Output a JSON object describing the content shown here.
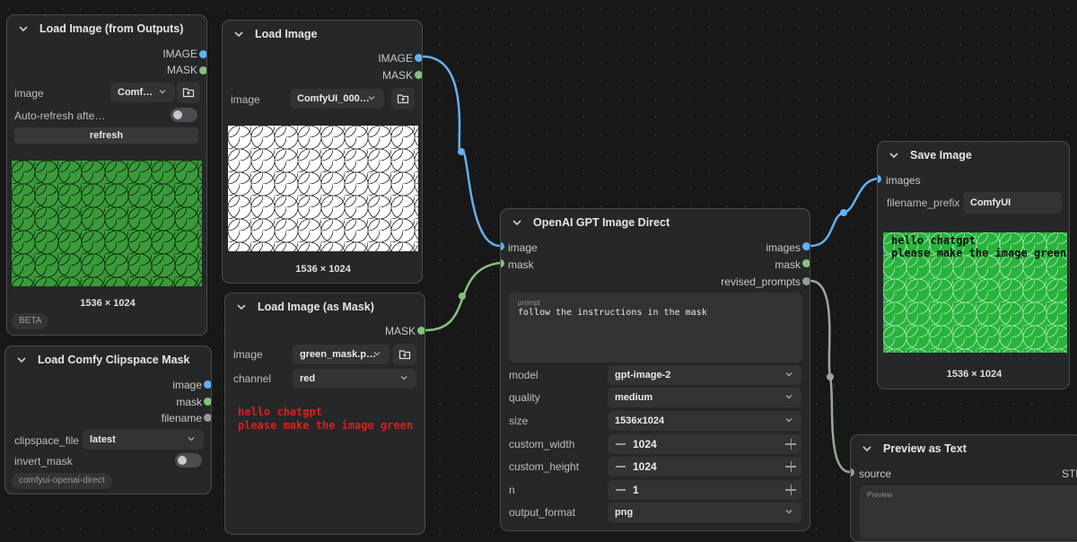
{
  "nodes": {
    "load_image_outputs": {
      "title": "Load Image (from Outputs)",
      "outputs": [
        "IMAGE",
        "MASK"
      ],
      "image_label": "image",
      "image_value": "Comf…",
      "auto_refresh_label": "Auto-refresh afte…",
      "auto_refresh_on": false,
      "refresh_label": "refresh",
      "dimensions": "1536 × 1024",
      "badge": "BETA"
    },
    "load_image": {
      "title": "Load Image",
      "outputs": [
        "IMAGE",
        "MASK"
      ],
      "image_label": "image",
      "image_value": "ComfyUI_000…",
      "dimensions": "1536 × 1024"
    },
    "load_image_mask": {
      "title": "Load Image (as Mask)",
      "outputs": [
        "MASK"
      ],
      "image_label": "image",
      "image_value": "green_mask.p…",
      "channel_label": "channel",
      "channel_value": "red",
      "preview_line1": "hello chatgpt",
      "preview_line2": "please make the image green"
    },
    "load_clipspace": {
      "title": "Load Comfy Clipspace Mask",
      "outputs": [
        "image",
        "mask",
        "filename"
      ],
      "clipspace_label": "clipspace_file",
      "clipspace_value": "latest",
      "invert_label": "invert_mask",
      "invert_on": false,
      "badge": "comfyui-openai-direct"
    },
    "openai": {
      "title": "OpenAI GPT Image Direct",
      "inputs": [
        "image",
        "mask"
      ],
      "outputs": [
        "images",
        "mask",
        "revised_prompts"
      ],
      "prompt_label": "prompt",
      "prompt_value": "follow the instructions in the mask",
      "widgets": [
        {
          "label": "model",
          "value": "gpt-image-2",
          "kind": "combo"
        },
        {
          "label": "quality",
          "value": "medium",
          "kind": "combo"
        },
        {
          "label": "size",
          "value": "1536x1024",
          "kind": "combo"
        },
        {
          "label": "custom_width",
          "value": "1024",
          "kind": "number"
        },
        {
          "label": "custom_height",
          "value": "1024",
          "kind": "number"
        },
        {
          "label": "n",
          "value": "1",
          "kind": "number"
        },
        {
          "label": "output_format",
          "value": "png",
          "kind": "combo"
        }
      ]
    },
    "save_image": {
      "title": "Save Image",
      "inputs": [
        "images"
      ],
      "prefix_label": "filename_prefix",
      "prefix_value": "ComfyUI",
      "overlay_line1": "hello chatgpt",
      "overlay_line2": "please make the image green",
      "dimensions": "1536 × 1024"
    },
    "preview_text": {
      "title": "Preview as Text",
      "inputs": [
        "source"
      ],
      "output_partial": "STR",
      "preview_label": "Preview"
    }
  },
  "colors": {
    "image_link": "#64b0f0",
    "mask_link": "#84c27c",
    "string_link": "#9aa79a",
    "mask_text": "#e01c1c"
  }
}
